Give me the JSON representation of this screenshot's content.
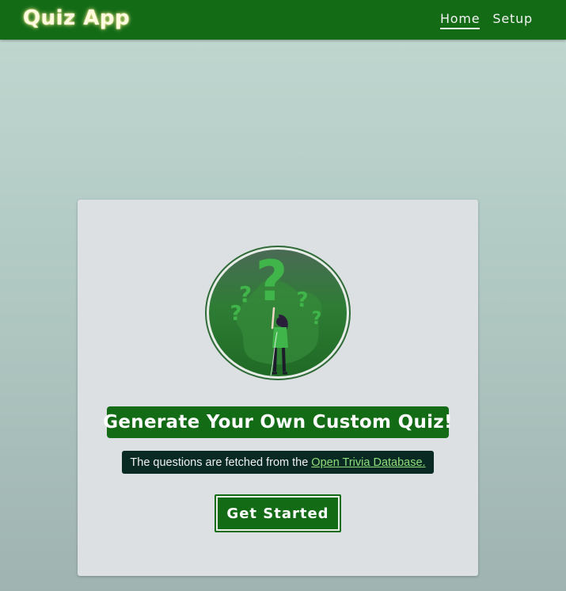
{
  "header": {
    "brand": "Quiz App",
    "nav": [
      {
        "label": "Home",
        "active": true
      },
      {
        "label": "Setup",
        "active": false
      }
    ]
  },
  "hero": {
    "illustration_icon": "question-marks-person-illustration",
    "headline": "Generate Your Own Custom Quiz!",
    "subline_text": "The questions are fetched from the",
    "subline_link": "Open Trivia Database.",
    "cta_label": "Get Started"
  },
  "colors": {
    "brand_green": "#136b16",
    "accent_green": "#3fb54a",
    "dark_teal": "#082a23",
    "card_bg": "#dce0e2",
    "link_green": "#8ee07a"
  }
}
